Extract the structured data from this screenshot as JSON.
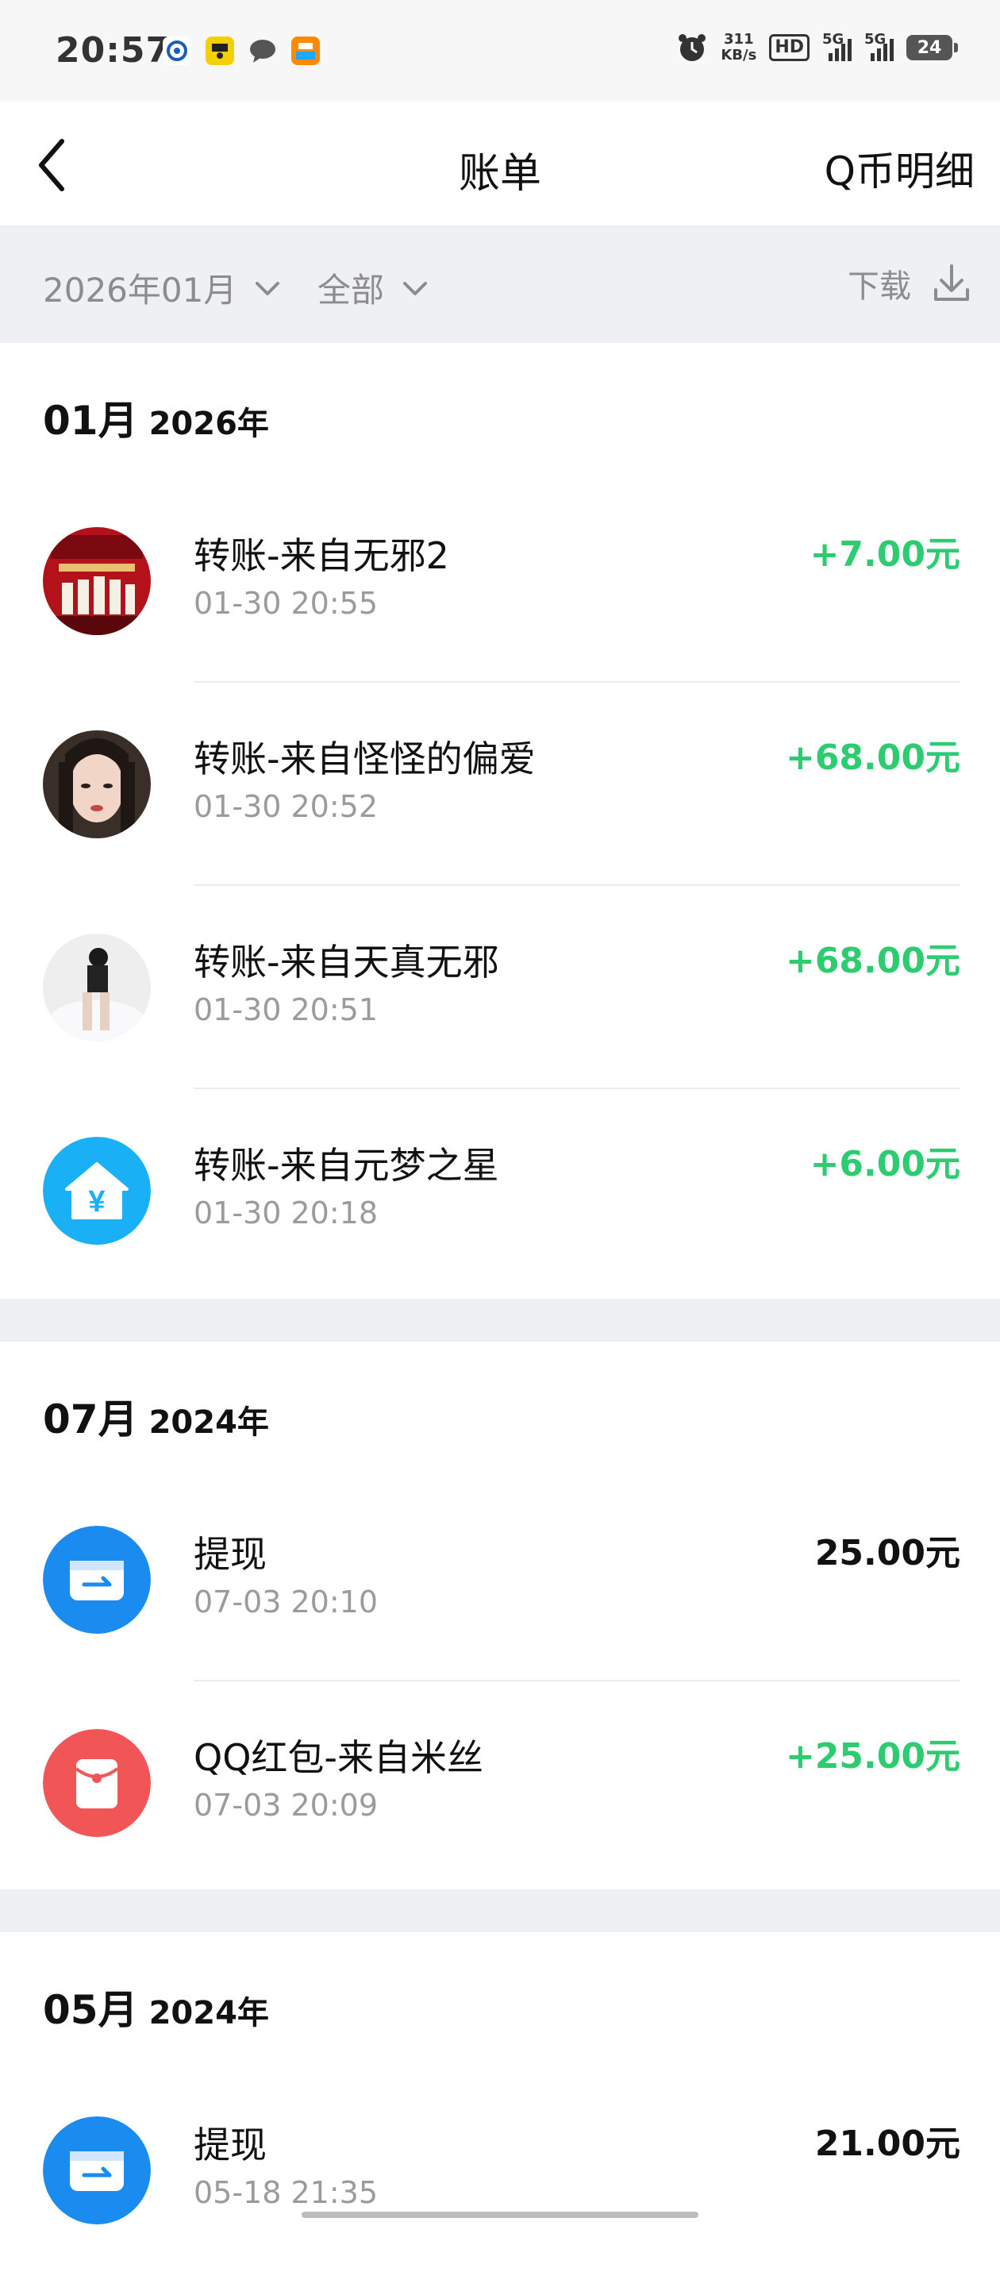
{
  "status_bar": {
    "time": "20:57",
    "net_speed_value": "311",
    "net_speed_unit": "KB/s",
    "hd_label": "HD",
    "signal1_label": "5G",
    "signal2_label": "5G",
    "battery": "24"
  },
  "nav": {
    "title": "账单",
    "right_label": "Q币明细"
  },
  "filters": {
    "month": "2026年01月",
    "category": "全部",
    "download": "下载"
  },
  "sections": [
    {
      "month": "01月",
      "year": "2026年",
      "items": [
        {
          "title": "转账-来自无邪2",
          "time": "01-30 20:55",
          "amount": "+7.00元",
          "avatar": "red-photo-avatar"
        },
        {
          "title": "转账-来自怪怪的偏爱",
          "time": "01-30 20:52",
          "amount": "+68.00元",
          "avatar": "portrait-avatar"
        },
        {
          "title": "转账-来自天真无邪",
          "time": "01-30 20:51",
          "amount": "+68.00元",
          "avatar": "sitting-figure-avatar"
        },
        {
          "title": "转账-来自元梦之星",
          "time": "01-30 20:18",
          "amount": "+6.00元",
          "avatar": "yuan-house-icon"
        }
      ]
    },
    {
      "month": "07月",
      "year": "2024年",
      "items": [
        {
          "title": "提现",
          "time": "07-03 20:10",
          "amount": "25.00元",
          "avatar": "withdraw-card-icon"
        },
        {
          "title": "QQ红包-来自米丝",
          "time": "07-03 20:09",
          "amount": "+25.00元",
          "avatar": "red-envelope-icon"
        }
      ]
    },
    {
      "month": "05月",
      "year": "2024年",
      "items": [
        {
          "title": "提现",
          "time": "05-18 21:35",
          "amount": "21.00元",
          "avatar": "withdraw-card-icon"
        }
      ]
    }
  ],
  "colors": {
    "income_green": "#2ecc71",
    "accent_blue": "#1a8cf0",
    "accent_red": "#f25555",
    "filter_bg": "#eff0f4"
  }
}
